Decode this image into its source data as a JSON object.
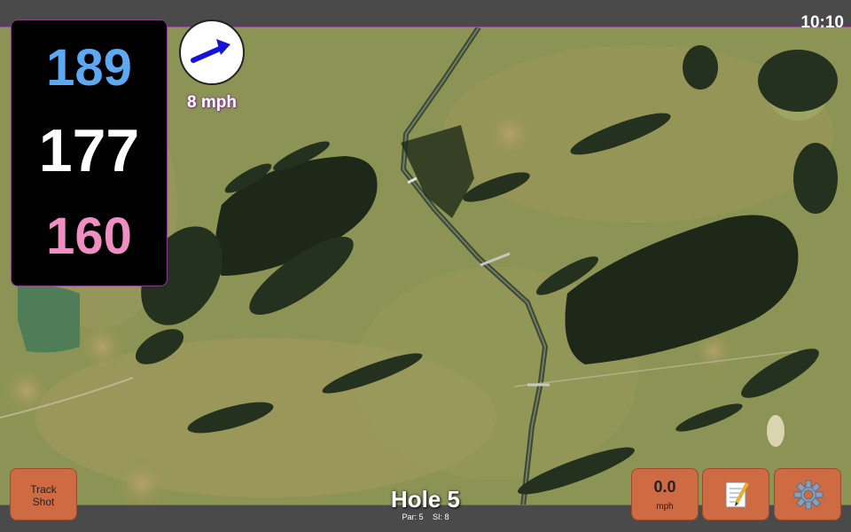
{
  "status_bar": {
    "time": "10:10"
  },
  "distances": {
    "back": "189",
    "center": "177",
    "front": "160"
  },
  "colors": {
    "back": "#5ea8f2",
    "center": "#ffffff",
    "front": "#ef8ec3",
    "button": "#cf6b43",
    "bar": "#4a4a4a"
  },
  "wind": {
    "speed_text": "8 mph",
    "direction": "northeast-arrow"
  },
  "hole": {
    "title": "Hole 5",
    "par": "Par: 5",
    "si": "SI: 8"
  },
  "buttons": {
    "track_shot": {
      "line1": "Track",
      "line2": "Shot"
    },
    "wind": {
      "value": "0.0",
      "unit": "mph"
    },
    "notes": {
      "icon": "notepad-icon"
    },
    "settings": {
      "icon": "gear-icon"
    }
  }
}
